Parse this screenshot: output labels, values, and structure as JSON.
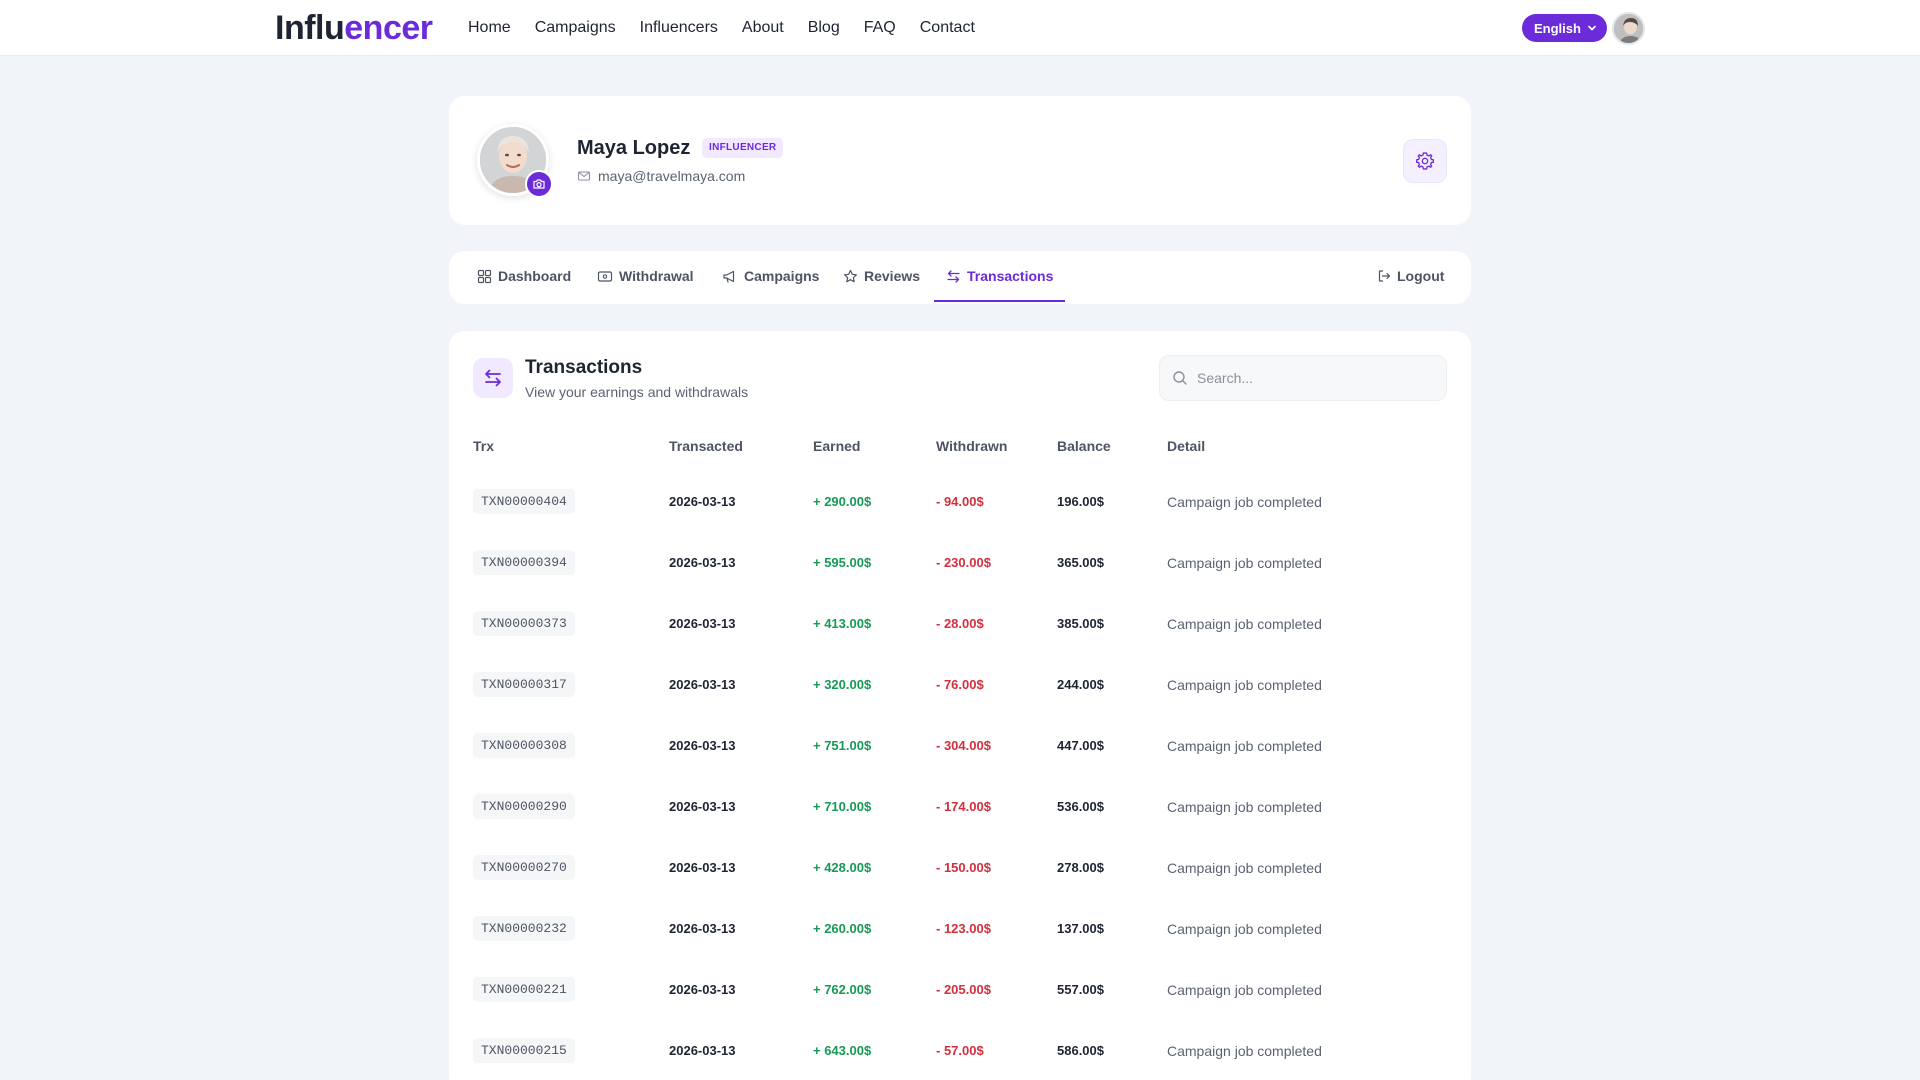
{
  "brand": {
    "part1": "Influ",
    "part2": "encer",
    "accent": "#6c2bd9"
  },
  "nav": {
    "links": [
      "Home",
      "Campaigns",
      "Influencers",
      "About",
      "Blog",
      "FAQ",
      "Contact"
    ],
    "language": "English",
    "language_icon": "chevron-down-icon",
    "avatar_icon": "user-avatar"
  },
  "profile": {
    "name": "Maya Lopez",
    "role": "INFLUENCER",
    "email": "maya@travelmaya.com",
    "email_icon": "mail-icon",
    "camera_icon": "camera-icon",
    "settings_icon": "gear-icon"
  },
  "tabs": {
    "items": [
      {
        "label": "Dashboard",
        "icon": "grid-icon",
        "active": false
      },
      {
        "label": "Withdrawal",
        "icon": "wallet-icon",
        "active": false
      },
      {
        "label": "Campaigns",
        "icon": "megaphone-icon",
        "active": false
      },
      {
        "label": "Reviews",
        "icon": "star-icon",
        "active": false
      },
      {
        "label": "Transactions",
        "icon": "arrows-exchange-icon",
        "active": true
      }
    ],
    "logout": "Logout"
  },
  "transactions": {
    "title": "Transactions",
    "subtitle": "View your earnings and withdrawals",
    "search_placeholder": "Search...",
    "columns": [
      "Trx",
      "Transacted",
      "Earned",
      "Withdrawn",
      "Balance",
      "Detail"
    ],
    "rows": [
      {
        "trx": "TXN00000404",
        "date": "2026-03-13",
        "earned": "+ 290.00$",
        "withdrawn": "- 94.00$",
        "balance": "196.00$",
        "detail": "Campaign job completed"
      },
      {
        "trx": "TXN00000394",
        "date": "2026-03-13",
        "earned": "+ 595.00$",
        "withdrawn": "- 230.00$",
        "balance": "365.00$",
        "detail": "Campaign job completed"
      },
      {
        "trx": "TXN00000373",
        "date": "2026-03-13",
        "earned": "+ 413.00$",
        "withdrawn": "- 28.00$",
        "balance": "385.00$",
        "detail": "Campaign job completed"
      },
      {
        "trx": "TXN00000317",
        "date": "2026-03-13",
        "earned": "+ 320.00$",
        "withdrawn": "- 76.00$",
        "balance": "244.00$",
        "detail": "Campaign job completed"
      },
      {
        "trx": "TXN00000308",
        "date": "2026-03-13",
        "earned": "+ 751.00$",
        "withdrawn": "- 304.00$",
        "balance": "447.00$",
        "detail": "Campaign job completed"
      },
      {
        "trx": "TXN00000290",
        "date": "2026-03-13",
        "earned": "+ 710.00$",
        "withdrawn": "- 174.00$",
        "balance": "536.00$",
        "detail": "Campaign job completed"
      },
      {
        "trx": "TXN00000270",
        "date": "2026-03-13",
        "earned": "+ 428.00$",
        "withdrawn": "- 150.00$",
        "balance": "278.00$",
        "detail": "Campaign job completed"
      },
      {
        "trx": "TXN00000232",
        "date": "2026-03-13",
        "earned": "+ 260.00$",
        "withdrawn": "- 123.00$",
        "balance": "137.00$",
        "detail": "Campaign job completed"
      },
      {
        "trx": "TXN00000221",
        "date": "2026-03-13",
        "earned": "+ 762.00$",
        "withdrawn": "- 205.00$",
        "balance": "557.00$",
        "detail": "Campaign job completed"
      },
      {
        "trx": "TXN00000215",
        "date": "2026-03-13",
        "earned": "+ 643.00$",
        "withdrawn": "- 57.00$",
        "balance": "586.00$",
        "detail": "Campaign job completed"
      }
    ]
  }
}
